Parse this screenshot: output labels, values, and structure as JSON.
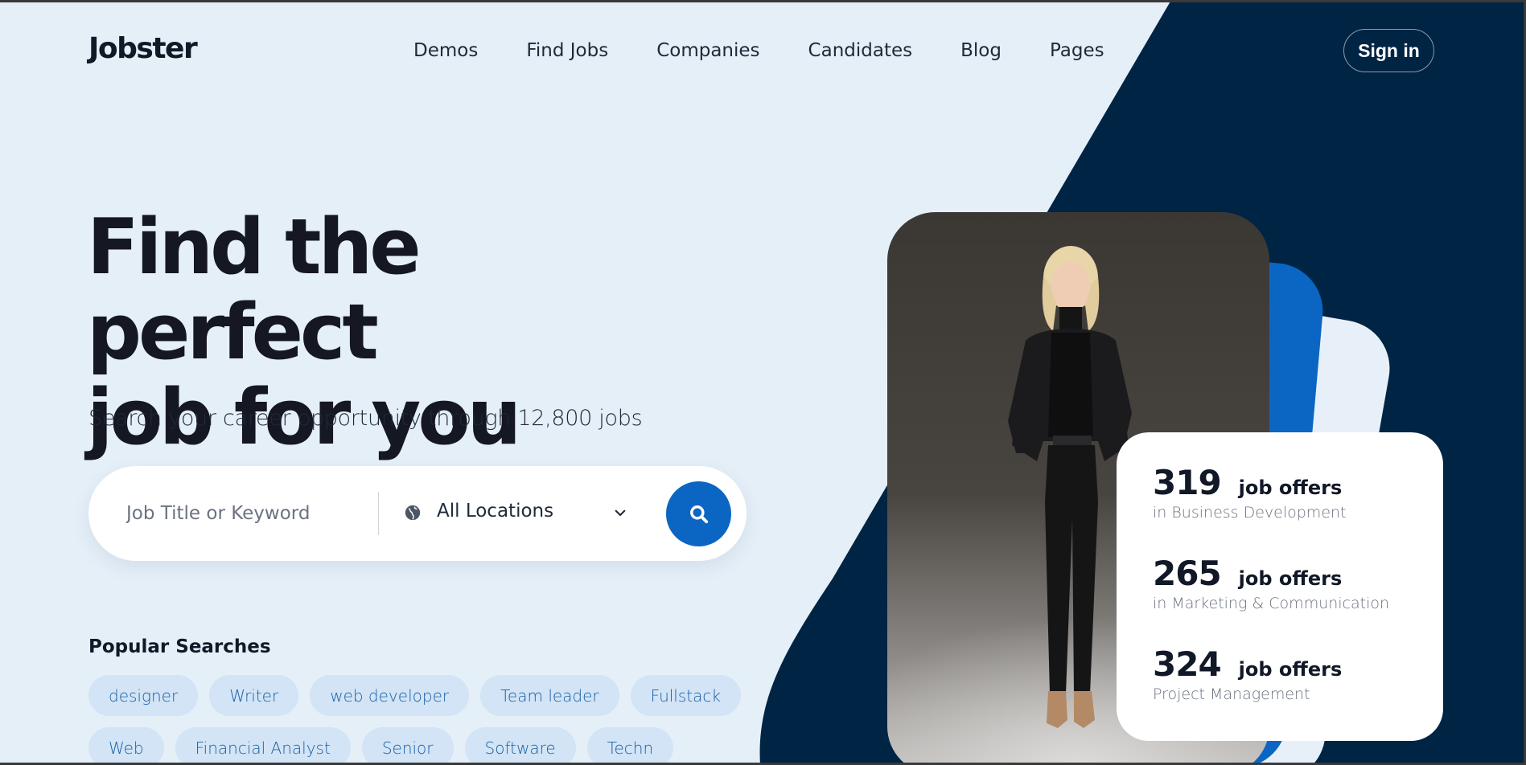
{
  "header": {
    "logo": "Jobster",
    "nav": [
      "Demos",
      "Find Jobs",
      "Companies",
      "Candidates",
      "Blog",
      "Pages"
    ],
    "signin_label": "Sign in"
  },
  "hero": {
    "title_line1": "Find the perfect",
    "title_line2": "job for you",
    "subtitle": "Search your career opportunity through 12,800 jobs"
  },
  "search": {
    "keyword_placeholder": "Job Title or Keyword",
    "location_label": "All Locations",
    "location_icon": "globe-icon",
    "dropdown_icon": "chevron-down-icon",
    "submit_icon": "search-icon"
  },
  "popular": {
    "title": "Popular Searches",
    "row1": [
      "designer",
      "Writer",
      "web developer",
      "Team leader",
      "Fullstack"
    ],
    "row2": [
      "Web",
      "Financial Analyst",
      "Senior",
      "Software",
      "Techn"
    ]
  },
  "stats": [
    {
      "count": "319",
      "label": "job offers",
      "category": "in Business Development"
    },
    {
      "count": "265",
      "label": "job offers",
      "category": "in Marketing & Communication"
    },
    {
      "count": "324",
      "label": "job offers",
      "category": "Project Management"
    }
  ],
  "colors": {
    "background": "#e5eff8",
    "navy": "#002444",
    "accent_blue": "#0b66c3",
    "tag_bg": "#d2e4f5",
    "tag_text": "#1a5fa8"
  }
}
